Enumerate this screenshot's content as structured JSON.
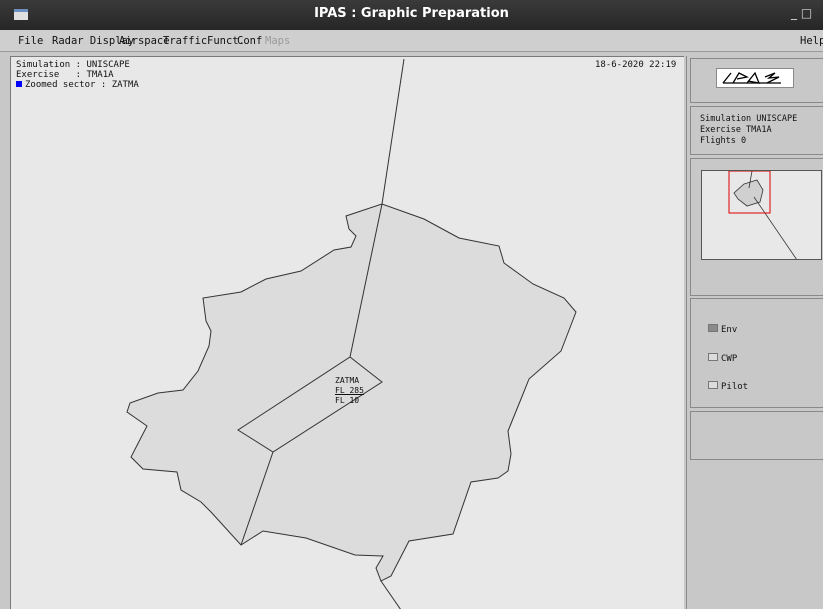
{
  "window": {
    "title": "IPAS : Graphic Preparation",
    "controls": "_ □"
  },
  "menu": {
    "items": [
      "File",
      "Radar Display",
      "Airspace",
      "Traffic",
      "Funct.",
      "Conf",
      "Maps"
    ],
    "help": "Help"
  },
  "map": {
    "simulation_line": "Simulation : UNISCAPE",
    "exercise_line": "Exercise   : TMA1A",
    "zoomed_line": "Zoomed sector : ZATMA",
    "timestamp": "18-6-2020 22:19",
    "sector_label": {
      "name": "ZATMA",
      "upper": "FL 285",
      "lower": "FL 10"
    },
    "zoom_marker_color": "#0000ff"
  },
  "side": {
    "simulation": "Simulation UNISCAPE",
    "exercise": "Exercise TMA1A",
    "flights": "Flights 0",
    "checkboxes": [
      {
        "label": "Env",
        "checked": true
      },
      {
        "label": "CWP",
        "checked": false
      },
      {
        "label": "Pilot",
        "checked": false
      }
    ]
  }
}
